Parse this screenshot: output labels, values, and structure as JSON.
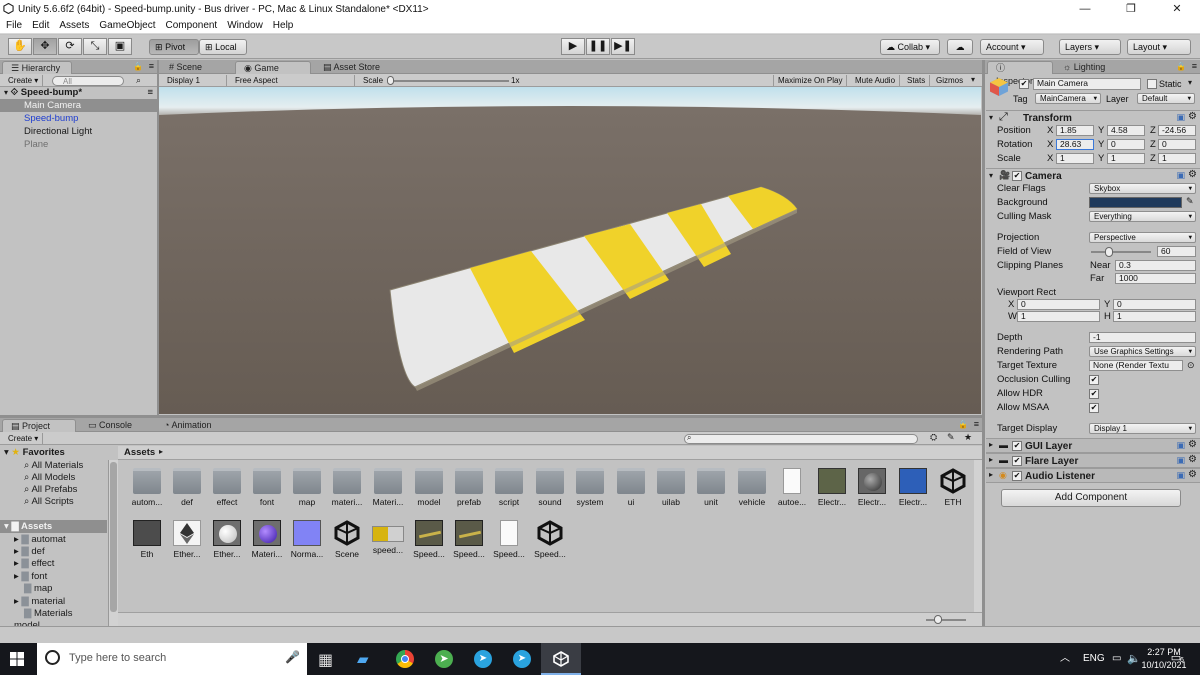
{
  "window": {
    "title": "Unity 5.6.6f2 (64bit) - Speed-bump.unity - Bus driver - PC, Mac & Linux Standalone* <DX11>",
    "min": "—",
    "max": "❐",
    "close": "✕"
  },
  "menu": [
    "File",
    "Edit",
    "Assets",
    "GameObject",
    "Component",
    "Window",
    "Help"
  ],
  "toolbar": {
    "pivot": "Pivot",
    "local": "Local",
    "collab": "Collab ▾",
    "account": "Account",
    "layers": "Layers",
    "layout": "Layout"
  },
  "hierarchy": {
    "tab": "Hierarchy",
    "create": "Create ▾",
    "search": "All",
    "scene": "Speed-bump*",
    "items": [
      {
        "label": "Main Camera",
        "selected": true
      },
      {
        "label": "Speed-bump",
        "color": "#1f3ed0"
      },
      {
        "label": "Directional Light"
      },
      {
        "label": "Plane",
        "color": "#707070"
      }
    ]
  },
  "center": {
    "tabs": {
      "scene": "Scene",
      "game": "Game",
      "asset_store": "Asset Store"
    },
    "display": "Display 1",
    "aspect": "Free Aspect",
    "scale_label": "Scale",
    "scale_value": "1x",
    "options": [
      "Maximize On Play",
      "Mute Audio",
      "Stats",
      "Gizmos"
    ]
  },
  "project": {
    "tabs": {
      "project": "Project",
      "console": "Console",
      "animation": "Animation"
    },
    "create": "Create ▾",
    "favorites": {
      "title": "Favorites",
      "items": [
        "All Materials",
        "All Models",
        "All Prefabs",
        "All Scripts"
      ]
    },
    "assets_root": "Assets",
    "tree": [
      "automat",
      "def",
      "effect",
      "font",
      "map",
      "material",
      "Materials",
      "model"
    ],
    "breadcrumb": "Assets",
    "grid_row1": [
      "autom...",
      "def",
      "effect",
      "font",
      "map",
      "materi...",
      "Materi...",
      "model",
      "prefab",
      "script",
      "sound",
      "system",
      "ui",
      "uilab",
      "unit",
      "vehicle",
      "autoe...",
      "Electr...",
      "Electr...",
      "Electr...",
      "ETH"
    ],
    "grid_row2": [
      "Eth",
      "Ether...",
      "Ether...",
      "Materi...",
      "Norma...",
      "Scene",
      "speed...",
      "Speed...",
      "Speed...",
      "Speed...",
      "Speed..."
    ]
  },
  "inspector": {
    "tabs": {
      "inspector": "Inspector",
      "lighting": "Lighting"
    },
    "object_name": "Main Camera",
    "static": "Static",
    "tag_label": "Tag",
    "tag": "MainCamera",
    "layer_label": "Layer",
    "layer": "Default",
    "transform": {
      "title": "Transform",
      "position": {
        "label": "Position",
        "x": "1.85",
        "y": "4.58",
        "z": "-24.56"
      },
      "rotation": {
        "label": "Rotation",
        "x": "28.63",
        "y": "0",
        "z": "0"
      },
      "scale": {
        "label": "Scale",
        "x": "1",
        "y": "1",
        "z": "1"
      }
    },
    "camera": {
      "title": "Camera",
      "clear_flags": {
        "label": "Clear Flags",
        "value": "Skybox"
      },
      "background": {
        "label": "Background",
        "color": "#1f3a5c"
      },
      "culling_mask": {
        "label": "Culling Mask",
        "value": "Everything"
      },
      "projection": {
        "label": "Projection",
        "value": "Perspective"
      },
      "fov": {
        "label": "Field of View",
        "value": "60",
        "fraction": 0.33
      },
      "clipping": {
        "label": "Clipping Planes",
        "near_label": "Near",
        "near": "0.3",
        "far_label": "Far",
        "far": "1000"
      },
      "viewport": {
        "label": "Viewport Rect",
        "x": "0",
        "y": "0",
        "w": "1",
        "h": "1"
      },
      "depth": {
        "label": "Depth",
        "value": "-1"
      },
      "rendering_path": {
        "label": "Rendering Path",
        "value": "Use Graphics Settings"
      },
      "target_texture": {
        "label": "Target Texture",
        "value": "None (Render Textu"
      },
      "occlusion": {
        "label": "Occlusion Culling"
      },
      "hdr": {
        "label": "Allow HDR"
      },
      "msaa": {
        "label": "Allow MSAA"
      },
      "target_display": {
        "label": "Target Display",
        "value": "Display 1"
      }
    },
    "components": [
      "GUI Layer",
      "Flare Layer",
      "Audio Listener"
    ],
    "add_component": "Add Component"
  },
  "taskbar": {
    "search": "Type here to search",
    "lang": "ENG",
    "time": "2:27 PM",
    "date": "10/10/2021",
    "notif": "6"
  }
}
